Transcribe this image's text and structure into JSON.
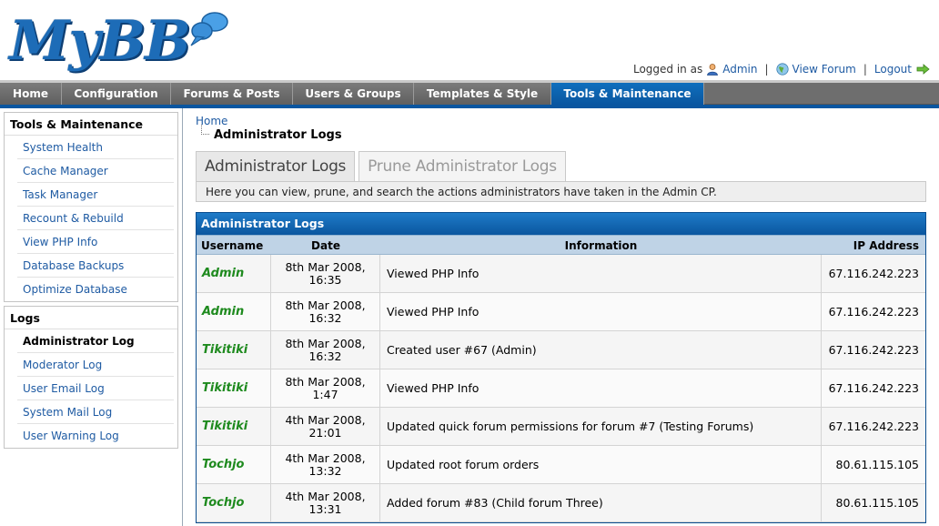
{
  "header": {
    "logo_text": "MyBB",
    "logged_in_as": "Logged in as",
    "username": "Admin",
    "view_forum": "View Forum",
    "logout": "Logout"
  },
  "nav": [
    {
      "label": "Home",
      "active": false
    },
    {
      "label": "Configuration",
      "active": false
    },
    {
      "label": "Forums & Posts",
      "active": false
    },
    {
      "label": "Users & Groups",
      "active": false
    },
    {
      "label": "Templates & Style",
      "active": false
    },
    {
      "label": "Tools & Maintenance",
      "active": true
    }
  ],
  "sidebar": {
    "tools_title": "Tools & Maintenance",
    "tools_items": [
      "System Health",
      "Cache Manager",
      "Task Manager",
      "Recount & Rebuild",
      "View PHP Info",
      "Database Backups",
      "Optimize Database"
    ],
    "logs_title": "Logs",
    "logs_items": [
      "Administrator Log",
      "Moderator Log",
      "User Email Log",
      "System Mail Log",
      "User Warning Log"
    ]
  },
  "breadcrumb": {
    "home": "Home",
    "current": "Administrator Logs"
  },
  "tabs": [
    {
      "label": "Administrator Logs",
      "active": true
    },
    {
      "label": "Prune Administrator Logs",
      "active": false
    }
  ],
  "description": "Here you can view, prune, and search the actions administrators have taken in the Admin CP.",
  "table": {
    "title": "Administrator Logs",
    "columns": [
      "Username",
      "Date",
      "Information",
      "IP Address"
    ],
    "rows": [
      {
        "username": "Admin",
        "date1": "8th Mar 2008,",
        "date2": "16:35",
        "info": "Viewed PHP Info",
        "ip": "67.116.242.223"
      },
      {
        "username": "Admin",
        "date1": "8th Mar 2008,",
        "date2": "16:32",
        "info": "Viewed PHP Info",
        "ip": "67.116.242.223"
      },
      {
        "username": "Tikitiki",
        "date1": "8th Mar 2008,",
        "date2": "16:32",
        "info": "Created user #67 (Admin)",
        "ip": "67.116.242.223"
      },
      {
        "username": "Tikitiki",
        "date1": "8th Mar 2008,",
        "date2": "1:47",
        "info": "Viewed PHP Info",
        "ip": "67.116.242.223"
      },
      {
        "username": "Tikitiki",
        "date1": "4th Mar 2008,",
        "date2": "21:01",
        "info": "Updated quick forum permissions for forum #7 (Testing Forums)",
        "ip": "67.116.242.223"
      },
      {
        "username": "Tochjo",
        "date1": "4th Mar 2008,",
        "date2": "13:32",
        "info": "Updated root forum orders",
        "ip": "80.61.115.105"
      },
      {
        "username": "Tochjo",
        "date1": "4th Mar 2008,",
        "date2": "13:31",
        "info": "Added forum #83 (Child forum Three)",
        "ip": "80.61.115.105"
      }
    ]
  },
  "colors": {
    "nav_active": "#0a56a0",
    "link": "#1f5ba3",
    "username": "#1e8a1e",
    "table_header": "#bfd3e6"
  }
}
